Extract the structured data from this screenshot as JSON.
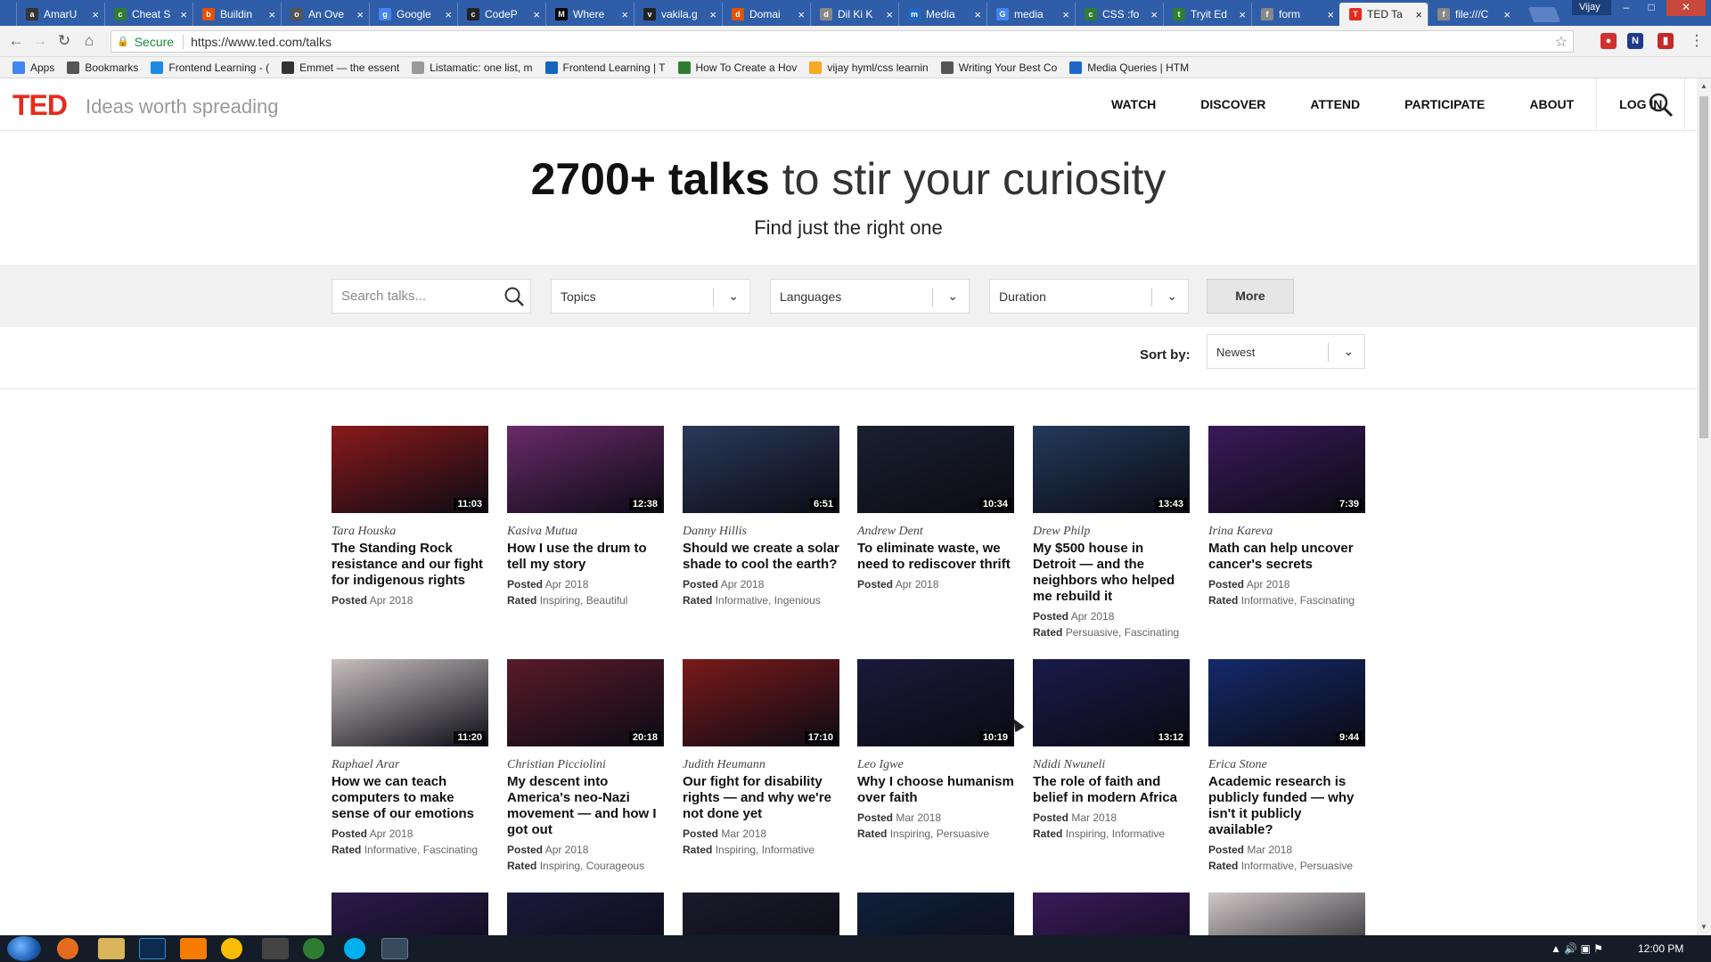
{
  "browser": {
    "tabs": [
      {
        "label": "AmarU",
        "color": "#333333",
        "glyph": "a"
      },
      {
        "label": "Cheat S",
        "color": "#2e7d32",
        "glyph": "c"
      },
      {
        "label": "Buildin",
        "color": "#e65100",
        "glyph": "b"
      },
      {
        "label": "An Ove",
        "color": "#555555",
        "glyph": "o"
      },
      {
        "label": "Google",
        "color": "#4285f4",
        "glyph": "g"
      },
      {
        "label": "CodeP",
        "color": "#222222",
        "glyph": "c"
      },
      {
        "label": "Where",
        "color": "#000000",
        "glyph": "M"
      },
      {
        "label": "vakila.g",
        "color": "#222222",
        "glyph": "v"
      },
      {
        "label": "Domai",
        "color": "#e65100",
        "glyph": "d"
      },
      {
        "label": "Dil Ki K",
        "color": "#888888",
        "glyph": "d"
      },
      {
        "label": "Media",
        "color": "#1e66c7",
        "glyph": "m"
      },
      {
        "label": "media",
        "color": "#4285f4",
        "glyph": "G"
      },
      {
        "label": "CSS :fo",
        "color": "#2e7d32",
        "glyph": "c"
      },
      {
        "label": "Tryit Ed",
        "color": "#2e7d32",
        "glyph": "t"
      },
      {
        "label": "form",
        "color": "#888888",
        "glyph": "f"
      },
      {
        "label": "TED Ta",
        "color": "#e62b1e",
        "glyph": "T",
        "active": true
      },
      {
        "label": "file:///C",
        "color": "#888888",
        "glyph": "f"
      }
    ],
    "user_badge": "Vijay",
    "address": {
      "secure_label": "Secure",
      "url": "https://www.ted.com/talks"
    },
    "bookmarks": [
      {
        "label": "Apps",
        "color": "#4285f4"
      },
      {
        "label": "Bookmarks",
        "color": "#555555"
      },
      {
        "label": "Frontend Learning - (",
        "color": "#1e88e5"
      },
      {
        "label": "Emmet — the essent",
        "color": "#333333"
      },
      {
        "label": "Listamatic: one list, m",
        "color": "#999999"
      },
      {
        "label": "Frontend Learning | T",
        "color": "#1565c0"
      },
      {
        "label": "How To Create a Hov",
        "color": "#2e7d32"
      },
      {
        "label": "vijay hyml/css learnin",
        "color": "#f9a825"
      },
      {
        "label": "Writing Your Best Co",
        "color": "#555555"
      },
      {
        "label": "Media Queries | HTM",
        "color": "#1e66c7"
      }
    ]
  },
  "site": {
    "logo": "TED",
    "tagline": "Ideas worth spreading",
    "nav": [
      "WATCH",
      "DISCOVER",
      "ATTEND",
      "PARTICIPATE",
      "ABOUT",
      "LOG IN"
    ]
  },
  "hero": {
    "title_bold": "2700+ talks",
    "title_rest": "to stir your curiosity",
    "subtitle": "Find just the right one"
  },
  "filters": {
    "search_placeholder": "Search talks...",
    "topics": "Topics",
    "languages": "Languages",
    "duration": "Duration",
    "more": "More"
  },
  "sort": {
    "label": "Sort by:",
    "value": "Newest"
  },
  "talks": [
    {
      "speaker": "Tara Houska",
      "title": "The Standing Rock resistance and our fight for indigenous rights",
      "posted": "Apr 2018",
      "rated": "",
      "duration": "11:03",
      "bg": "#8a1a1a"
    },
    {
      "speaker": "Kasiva Mutua",
      "title": "How I use the drum to tell my story",
      "posted": "Apr 2018",
      "rated": "Inspiring, Beautiful",
      "duration": "12:38",
      "bg": "#6a2a6a"
    },
    {
      "speaker": "Danny Hillis",
      "title": "Should we create a solar shade to cool the earth?",
      "posted": "Apr 2018",
      "rated": "Informative, Ingenious",
      "duration": "6:51",
      "bg": "#2a3a5a"
    },
    {
      "speaker": "Andrew Dent",
      "title": "To eliminate waste, we need to rediscover thrift",
      "posted": "Apr 2018",
      "rated": "",
      "duration": "10:34",
      "bg": "#1a2030"
    },
    {
      "speaker": "Drew Philp",
      "title": "My $500 house in Detroit — and the neighbors who helped me rebuild it",
      "posted": "Apr 2018",
      "rated": "Persuasive, Fascinating",
      "duration": "13:43",
      "bg": "#233a5a"
    },
    {
      "speaker": "Irina Kareva",
      "title": "Math can help uncover cancer's secrets",
      "posted": "Apr 2018",
      "rated": "Informative, Fascinating",
      "duration": "7:39",
      "bg": "#3a1a5a"
    },
    {
      "speaker": "Raphael Arar",
      "title": "How we can teach computers to make sense of our emotions",
      "posted": "Apr 2018",
      "rated": "Informative, Fascinating",
      "duration": "11:20",
      "bg": "#c8c0c0"
    },
    {
      "speaker": "Christian Picciolini",
      "title": "My descent into America's neo-Nazi movement — and how I got out",
      "posted": "Apr 2018",
      "rated": "Inspiring, Courageous",
      "duration": "20:18",
      "bg": "#5a1a2a"
    },
    {
      "speaker": "Judith Heumann",
      "title": "Our fight for disability rights — and why we're not done yet",
      "posted": "Mar 2018",
      "rated": "Inspiring, Informative",
      "duration": "17:10",
      "bg": "#7a1a1a"
    },
    {
      "speaker": "Leo Igwe",
      "title": "Why I choose humanism over faith",
      "posted": "Mar 2018",
      "rated": "Inspiring, Persuasive",
      "duration": "10:19",
      "bg": "#1a1a3a"
    },
    {
      "speaker": "Ndidi Nwuneli",
      "title": "The role of faith and belief in modern Africa",
      "posted": "Mar 2018",
      "rated": "Inspiring, Informative",
      "duration": "13:12",
      "bg": "#1a1a4a"
    },
    {
      "speaker": "Erica Stone",
      "title": "Academic research is publicly funded — why isn't it publicly available?",
      "posted": "Mar 2018",
      "rated": "Informative, Persuasive",
      "duration": "9:44",
      "bg": "#142a6a"
    },
    {
      "speaker": "",
      "title": "",
      "posted": "",
      "rated": "",
      "duration": "",
      "bg": "#2a1a4a"
    },
    {
      "speaker": "",
      "title": "",
      "posted": "",
      "rated": "",
      "duration": "",
      "bg": "#1a1a3a"
    },
    {
      "speaker": "",
      "title": "",
      "posted": "",
      "rated": "",
      "duration": "",
      "bg": "#1a1a2a"
    },
    {
      "speaker": "",
      "title": "",
      "posted": "",
      "rated": "",
      "duration": "",
      "bg": "#10203a"
    },
    {
      "speaker": "",
      "title": "",
      "posted": "",
      "rated": "",
      "duration": "",
      "bg": "#3a1a5a"
    },
    {
      "speaker": "",
      "title": "",
      "posted": "",
      "rated": "",
      "duration": "",
      "bg": "#d0c8c8"
    }
  ],
  "labels": {
    "posted": "Posted",
    "rated": "Rated"
  },
  "taskbar": {
    "clock": "12:00 PM"
  }
}
